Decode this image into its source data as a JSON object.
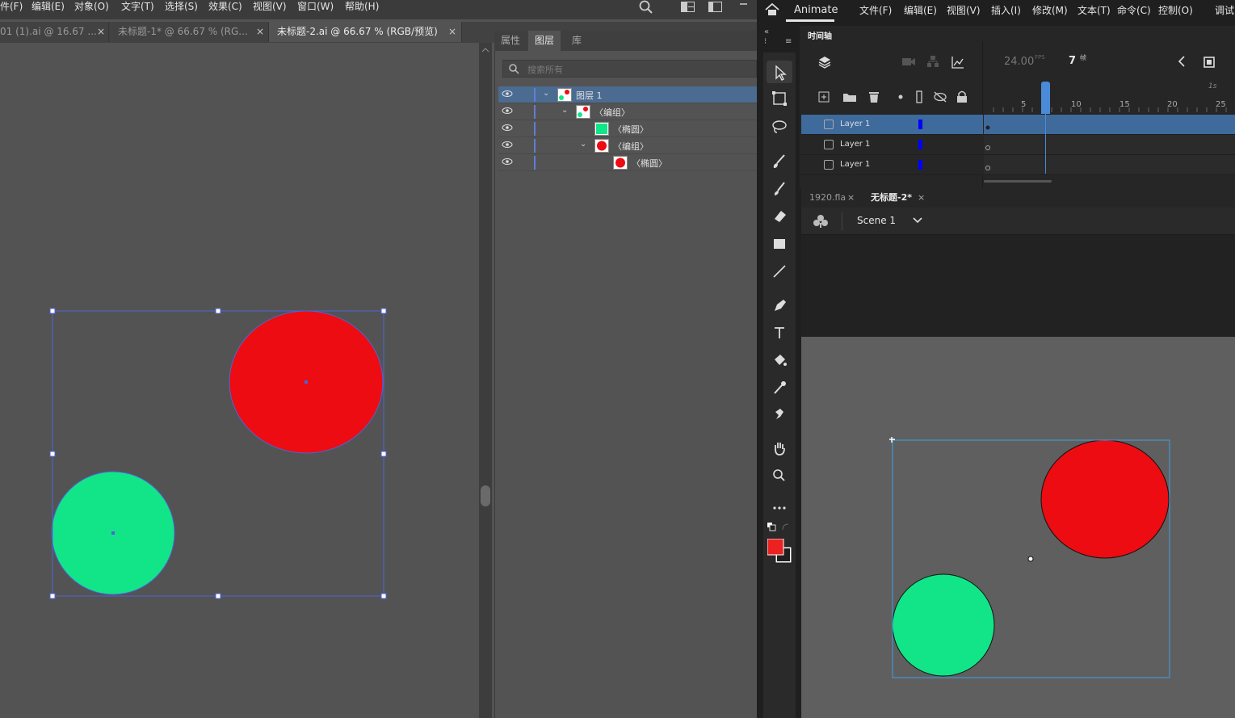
{
  "illustrator": {
    "menu": [
      "件(F)",
      "编辑(E)",
      "对象(O)",
      "文字(T)",
      "选择(S)",
      "效果(C)",
      "视图(V)",
      "窗口(W)",
      "帮助(H)"
    ],
    "doc_tabs": [
      {
        "label": "01 (1).ai @ 16.67 ...",
        "close": "×"
      },
      {
        "label": "未标题-1* @ 66.67 % (RG...",
        "close": "×"
      },
      {
        "label": "未标题-2.ai @ 66.67 % (RGB/预览)",
        "close": "×"
      }
    ],
    "panel_tabs": [
      "属性",
      "图层",
      "库"
    ],
    "search_placeholder": "搜索所有",
    "layers": [
      {
        "label": "图层 1"
      },
      {
        "label": "〈编组〉"
      },
      {
        "label": "〈椭圆〉"
      },
      {
        "label": "〈编组〉"
      },
      {
        "label": "〈椭圆〉"
      }
    ],
    "colors": {
      "red": "#ec0c12",
      "green": "#12e588",
      "selection": "#4f63d8"
    }
  },
  "animate": {
    "app_name": "Animate",
    "menu": [
      "文件(F)",
      "编辑(E)",
      "视图(V)",
      "插入(I)",
      "修改(M)",
      "文本(T)",
      "命令(C)",
      "控制(O)",
      "调试"
    ],
    "timeline_title": "时间轴",
    "fps": "24.00",
    "fps_unit": "FPS",
    "frame": "7",
    "frame_unit": "帧",
    "ruler": [
      "5",
      "10",
      "15",
      "20",
      "25"
    ],
    "ruler_seconds": "1s",
    "layers": [
      {
        "name": "Layer 1"
      },
      {
        "name": "Layer 1"
      },
      {
        "name": "Layer 1"
      }
    ],
    "doc_tabs": [
      {
        "label": "1920.fla",
        "close": "×"
      },
      {
        "label": "无标题-2*",
        "close": "×"
      }
    ],
    "scene": "Scene 1"
  }
}
